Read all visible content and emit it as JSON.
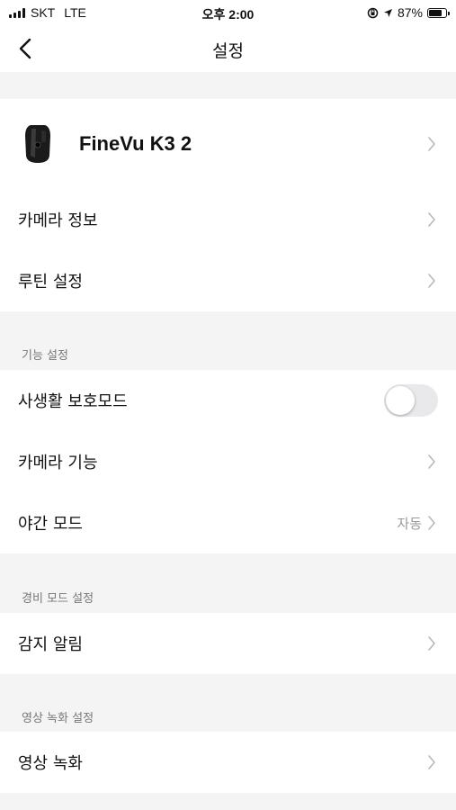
{
  "status_bar": {
    "carrier": "SKT",
    "network": "LTE",
    "time": "오후 2:00",
    "battery_percent": "87%",
    "battery_level": 0.87
  },
  "nav": {
    "title": "설정",
    "back_icon": "chevron-left-icon"
  },
  "device": {
    "name": "FineVu K3 2",
    "image_icon": "dashcam-device-icon"
  },
  "main_items": [
    {
      "label": "카메라 정보"
    },
    {
      "label": "루틴 설정"
    }
  ],
  "sections": [
    {
      "header": "기능 설정",
      "items": [
        {
          "label": "사생활 보호모드",
          "control": "toggle",
          "toggle_on": false
        },
        {
          "label": "카메라 기능"
        },
        {
          "label": "야간 모드",
          "value": "자동"
        }
      ]
    },
    {
      "header": "경비 모드 설정",
      "items": [
        {
          "label": "감지 알림"
        }
      ]
    },
    {
      "header": "영상 녹화 설정",
      "items": [
        {
          "label": "영상 녹화"
        }
      ]
    }
  ],
  "colors": {
    "background": "#f4f4f4",
    "card": "#ffffff",
    "secondary_text": "#9a9a9a",
    "toggle_off": "#e9e9ec"
  }
}
